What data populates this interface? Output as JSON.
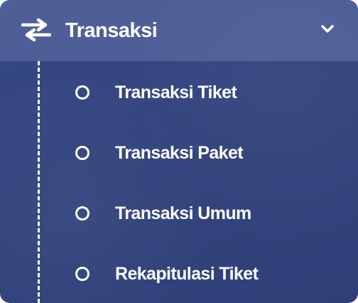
{
  "menu": {
    "label": "Transaksi",
    "icon": "swap-arrows-icon",
    "expanded": true,
    "toggle_icon": "chevron-down-icon",
    "items": [
      {
        "label": "Transaksi Tiket",
        "icon": "circle-outline-icon"
      },
      {
        "label": "Transaksi Paket",
        "icon": "circle-outline-icon"
      },
      {
        "label": "Transaksi Umum",
        "icon": "circle-outline-icon"
      },
      {
        "label": "Rekapitulasi Tiket",
        "icon": "circle-outline-icon"
      }
    ]
  },
  "colors": {
    "header_bg": "#4e5f98",
    "panel_bg": "#34457f",
    "text": "#ffffff"
  }
}
